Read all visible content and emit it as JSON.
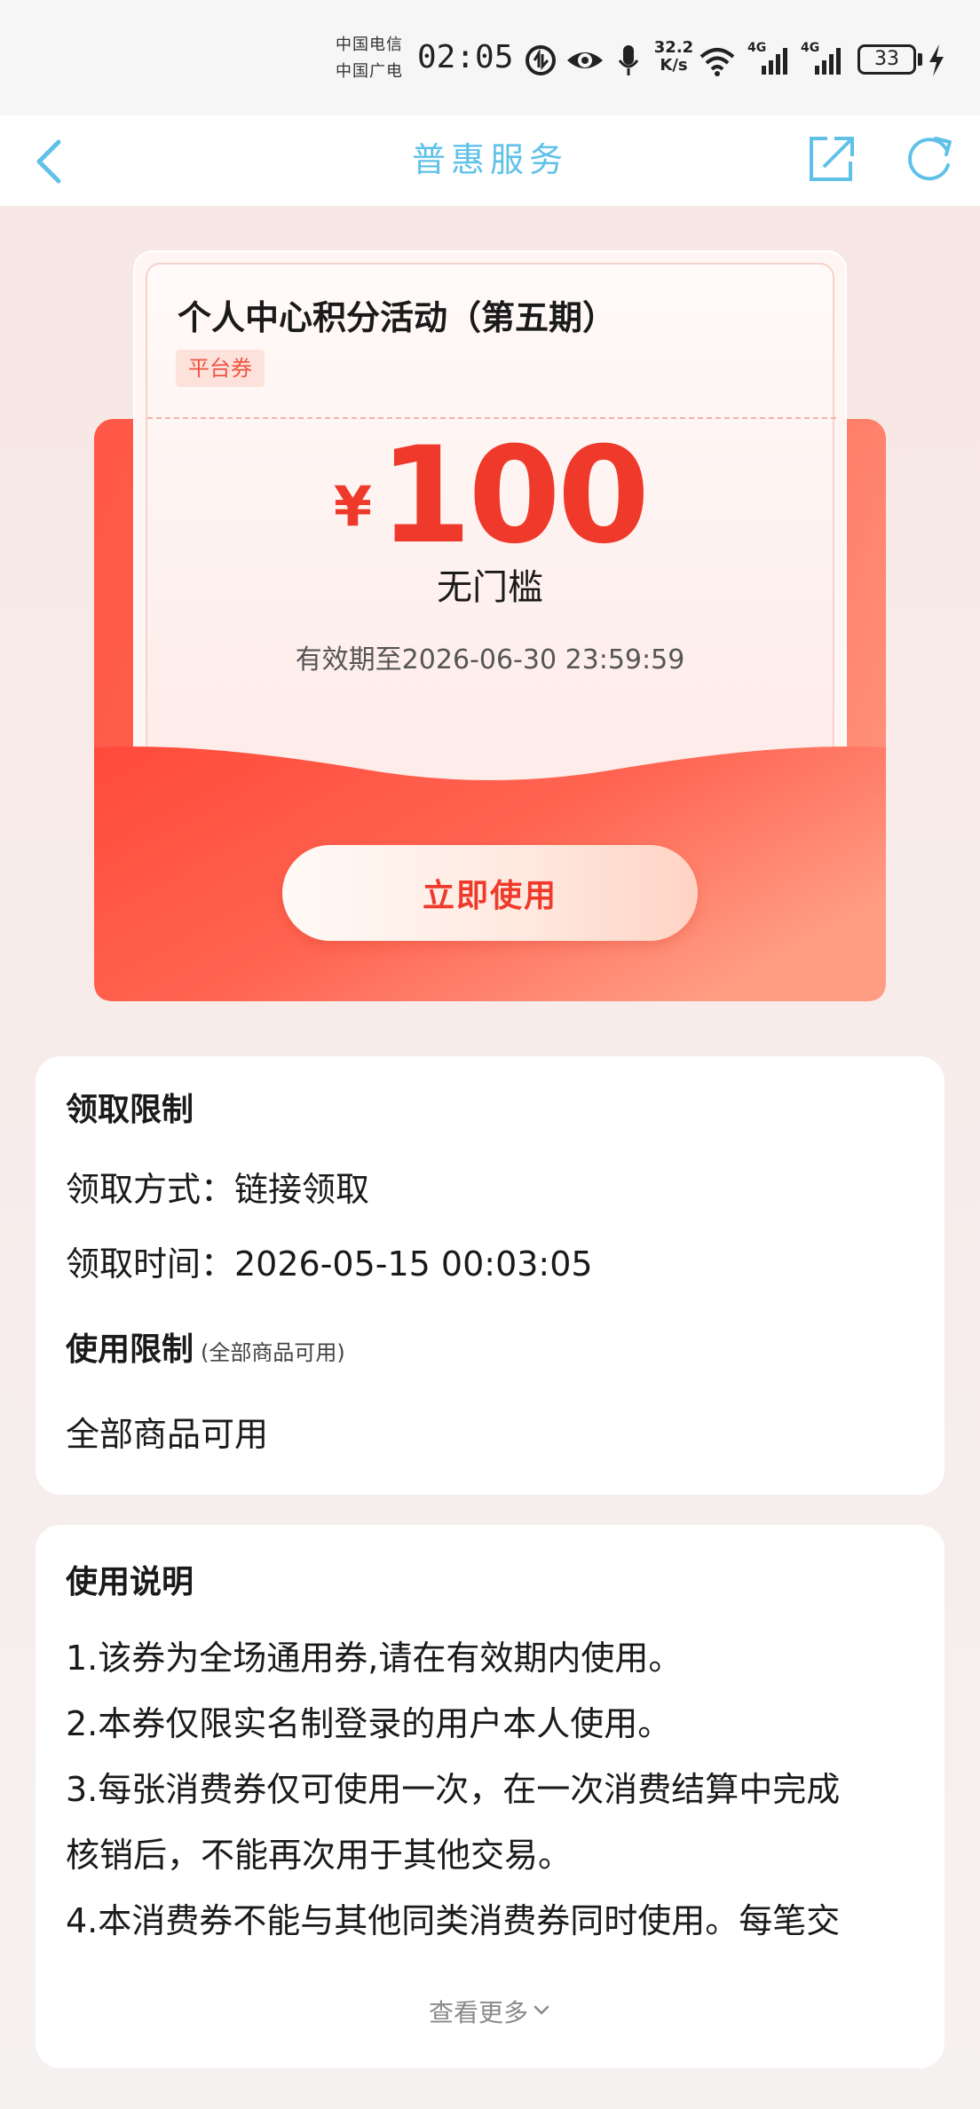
{
  "status_bar": {
    "carrier_1": "中国电信",
    "carrier_2": "中国广电",
    "time": "02:05",
    "net_speed_value": "32.2",
    "net_speed_unit": "K/s",
    "signal_1_label": "4G",
    "signal_2_label": "4G",
    "battery_level": "33"
  },
  "nav": {
    "title": "普惠服务"
  },
  "coupon": {
    "title": "个人中心积分活动（第五期）",
    "tag": "平台券",
    "currency": "¥",
    "amount": "100",
    "threshold": "无门槛",
    "validity": "有效期至2026-06-30 23:59:59",
    "use_button": "立即使用"
  },
  "restrictions": {
    "heading": "领取限制",
    "method": "领取方式：链接领取",
    "time": "领取时间：2026-05-15 00:03:05",
    "usage_heading": "使用限制",
    "usage_sub": "(全部商品可用)",
    "usage_value": "全部商品可用"
  },
  "notes": {
    "heading": "使用说明",
    "lines": [
      "1.该券为全场通用券,请在有效期内使用。",
      "2.本券仅限实名制登录的用户本人使用。",
      "3.每张消费券仅可使用一次，在一次消费结算中完成",
      "核销后，不能再次用于其他交易。",
      "4.本消费券不能与其他同类消费券同时使用。每笔交"
    ],
    "see_more": "查看更多"
  },
  "colors": {
    "accent_red": "#ef3a2b",
    "nav_blue": "#5fc1e8"
  }
}
